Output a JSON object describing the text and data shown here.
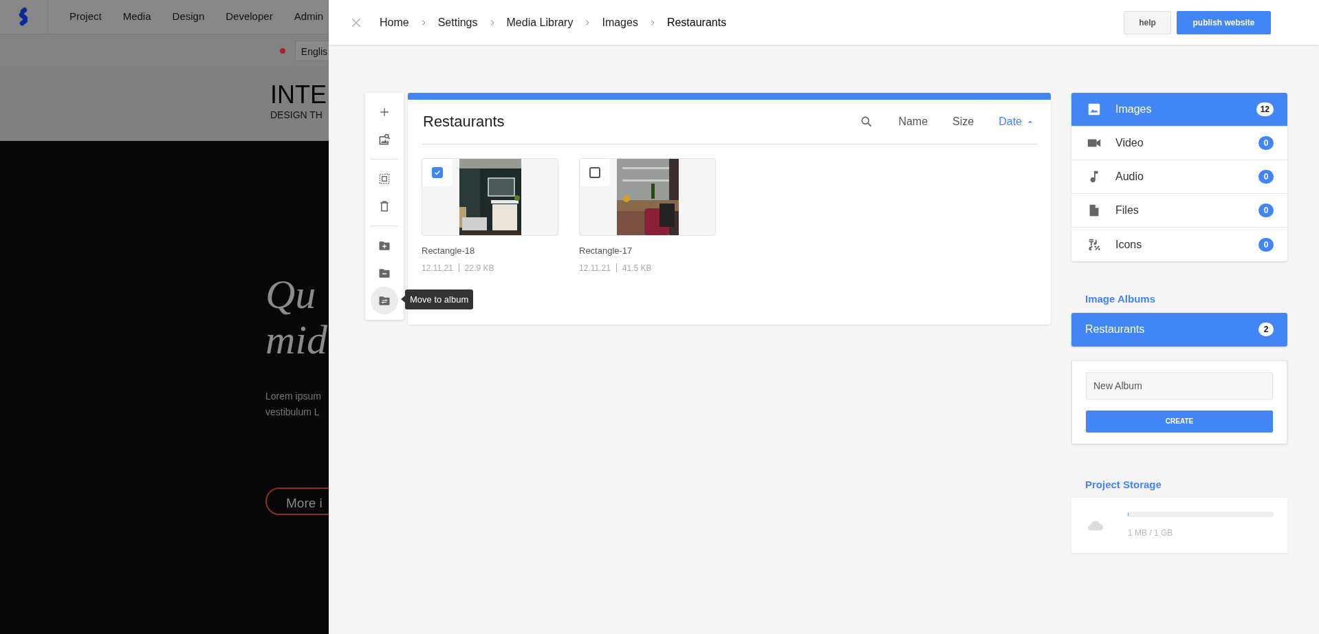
{
  "background": {
    "nav": [
      "Project",
      "Media",
      "Design",
      "Developer",
      "Admin"
    ],
    "language": "Englis",
    "brand": "INTE",
    "tagline": "DESIGN TH",
    "headline": [
      "Qu",
      "mid"
    ],
    "text": [
      "Lorem ipsum",
      "vestibulum L"
    ],
    "button": "More i"
  },
  "breadcrumb": [
    "Home",
    "Settings",
    "Media Library",
    "Images",
    "Restaurants"
  ],
  "header_buttons": [
    {
      "label": "help",
      "kind": "secondary"
    },
    {
      "label": "publish website",
      "kind": "primary"
    }
  ],
  "toolbar": [
    {
      "selected": false
    },
    {
      "selected": false
    },
    {
      "selected": false
    },
    {
      "selected": false
    },
    {
      "selected": false
    },
    {
      "selected": false
    },
    {
      "selected": true
    }
  ],
  "tooltip": "Move to album",
  "library": {
    "title": "Restaurants",
    "sort": [
      {
        "label": "Name",
        "selected": false
      },
      {
        "label": "Size",
        "selected": false
      },
      {
        "label": "Date",
        "selected": true
      }
    ],
    "files": [
      {
        "name": "Rectangle-18",
        "date": "12.11.21",
        "size": "22.9 KB",
        "checked": true
      },
      {
        "name": "Rectangle-17",
        "date": "12.11.21",
        "size": "41.5 KB",
        "checked": false
      }
    ]
  },
  "sidebar": {
    "types": [
      {
        "label": "Images",
        "count": "12",
        "selected": true
      },
      {
        "label": "Video",
        "count": "0",
        "selected": false
      },
      {
        "label": "Audio",
        "count": "0",
        "selected": false
      },
      {
        "label": "Files",
        "count": "0",
        "selected": false
      },
      {
        "label": "Icons",
        "count": "0",
        "selected": false
      }
    ],
    "albums_title": "Image Albums",
    "albums": [
      {
        "label": "Restaurants",
        "count": "2",
        "selected": true
      }
    ],
    "new_album": {
      "placeholder": "New Album",
      "button": "CREATE"
    },
    "storage_title": "Project Storage",
    "storage": {
      "level": 0.005,
      "reading": "1 MB / 1 GB"
    }
  }
}
